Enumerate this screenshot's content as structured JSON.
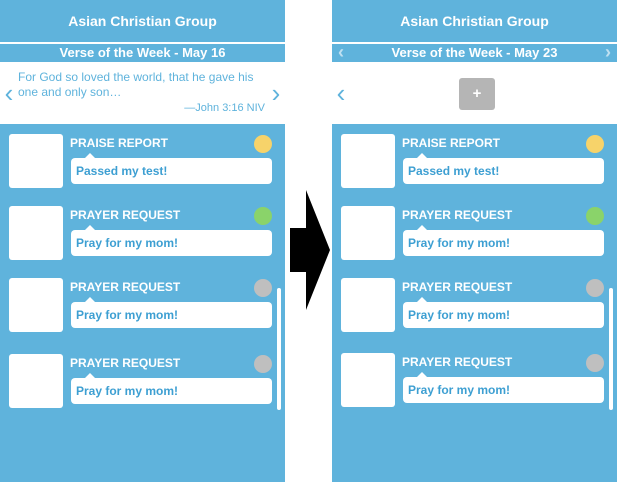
{
  "left": {
    "app_title": "Asian Christian Group",
    "verse_header": "Verse of the Week - May 16",
    "verse_text": "For God so loved the world, that he gave his one and only son…",
    "verse_reference": "—John 3:16 NIV",
    "items": [
      {
        "type": "PRAISE REPORT",
        "message": "Passed my test!",
        "status_color": "#f7d36a"
      },
      {
        "type": "PRAYER REQUEST",
        "message": "Pray for my mom!",
        "status_color": "#8ad36a"
      },
      {
        "type": "PRAYER REQUEST",
        "message": "Pray for my mom!",
        "status_color": "#bfbfbf"
      },
      {
        "type": "PRAYER REQUEST",
        "message": "Pray for my mom!",
        "status_color": "#bfbfbf"
      }
    ]
  },
  "right": {
    "app_title": "Asian Christian Group",
    "verse_header": "Verse of the Week - May 23",
    "add_label": "+",
    "items": [
      {
        "type": "PRAISE REPORT",
        "message": "Passed my test!",
        "status_color": "#f7d36a"
      },
      {
        "type": "PRAYER REQUEST",
        "message": "Pray for my mom!",
        "status_color": "#8ad36a"
      },
      {
        "type": "PRAYER REQUEST",
        "message": "Pray for my mom!",
        "status_color": "#bfbfbf"
      },
      {
        "type": "PRAYER REQUEST",
        "message": "Pray for my mom!",
        "status_color": "#bfbfbf"
      }
    ]
  },
  "colors": {
    "accent": "#5fb3dc",
    "text_blue": "#3d9fd2",
    "add_button": "#b5b5b5"
  },
  "icons": {
    "prev": "chevron-left-icon",
    "next": "chevron-right-icon",
    "transition": "arrow-right-icon"
  }
}
